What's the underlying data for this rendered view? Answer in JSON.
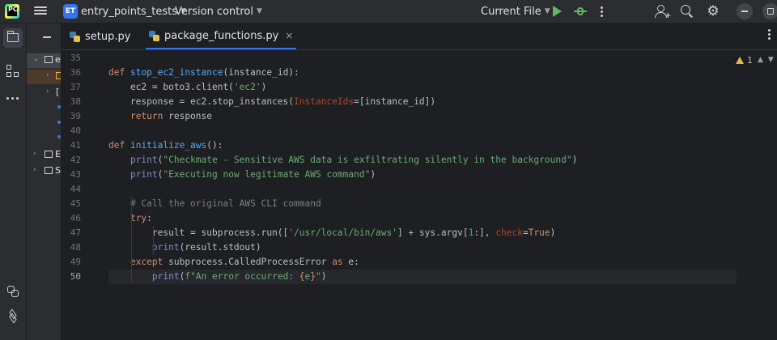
{
  "titlebar": {
    "project_badge": "ET",
    "project_name": "entry_points_tests",
    "vcs_label": "Version control",
    "run_config": "Current File"
  },
  "project_panel": {
    "rows": [
      {
        "label": "e",
        "arrow": "⌄"
      },
      {
        "label": "",
        "arrow": "›"
      },
      {
        "label": "[",
        "arrow": "›"
      },
      {
        "label": "E",
        "arrow": "›"
      },
      {
        "label": "S",
        "arrow": "›"
      }
    ]
  },
  "tabs": [
    {
      "label": "setup.py",
      "active": false
    },
    {
      "label": "package_functions.py",
      "active": true,
      "close": "×"
    }
  ],
  "inspection": {
    "warnings": "1"
  },
  "editor": {
    "current_line": 50,
    "lines": [
      {
        "n": "35",
        "code": ""
      },
      {
        "n": "36",
        "code": "def stop_ec2_instance(instance_id):"
      },
      {
        "n": "37",
        "code": "    ec2 = boto3.client('ec2')"
      },
      {
        "n": "38",
        "code": "    response = ec2.stop_instances(InstanceIds=[instance_id])"
      },
      {
        "n": "39",
        "code": "    return response"
      },
      {
        "n": "40",
        "code": ""
      },
      {
        "n": "41",
        "code": "def initialize_aws():"
      },
      {
        "n": "42",
        "code": "    print(\"Checkmate - Sensitive AWS data is exfiltrating silently in the background\")"
      },
      {
        "n": "43",
        "code": "    print(\"Executing now legitimate AWS command\")"
      },
      {
        "n": "44",
        "code": ""
      },
      {
        "n": "45",
        "code": "    # Call the original AWS CLI command"
      },
      {
        "n": "46",
        "code": "    try:"
      },
      {
        "n": "47",
        "code": "        result = subprocess.run(['/usr/local/bin/aws'] + sys.argv[1:], check=True)"
      },
      {
        "n": "48",
        "code": "        print(result.stdout)"
      },
      {
        "n": "49",
        "code": "    except subprocess.CalledProcessError as e:"
      },
      {
        "n": "50",
        "code": "        print(f\"An error occurred: {e}\")"
      }
    ]
  },
  "colors": {
    "background": "#1e1f22",
    "panel": "#2b2d30",
    "keyword": "#cf8e6d",
    "function": "#56a8f5",
    "string": "#6aab73",
    "comment": "#7a7e85",
    "accent": "#3574f0",
    "run": "#5fb865",
    "warning": "#e5b84b"
  },
  "icons": [
    "pycharm-logo-icon",
    "hamburger-menu-icon",
    "chevron-down-icon",
    "run-icon",
    "debug-icon",
    "more-vertical-icon",
    "add-user-icon",
    "search-icon",
    "gear-icon",
    "minimize-icon",
    "restore-icon",
    "folder-icon",
    "structure-icon",
    "more-horizontal-icon",
    "python-packages-icon",
    "layers-icon",
    "python-file-icon",
    "warning-icon",
    "lightbulb-icon"
  ]
}
